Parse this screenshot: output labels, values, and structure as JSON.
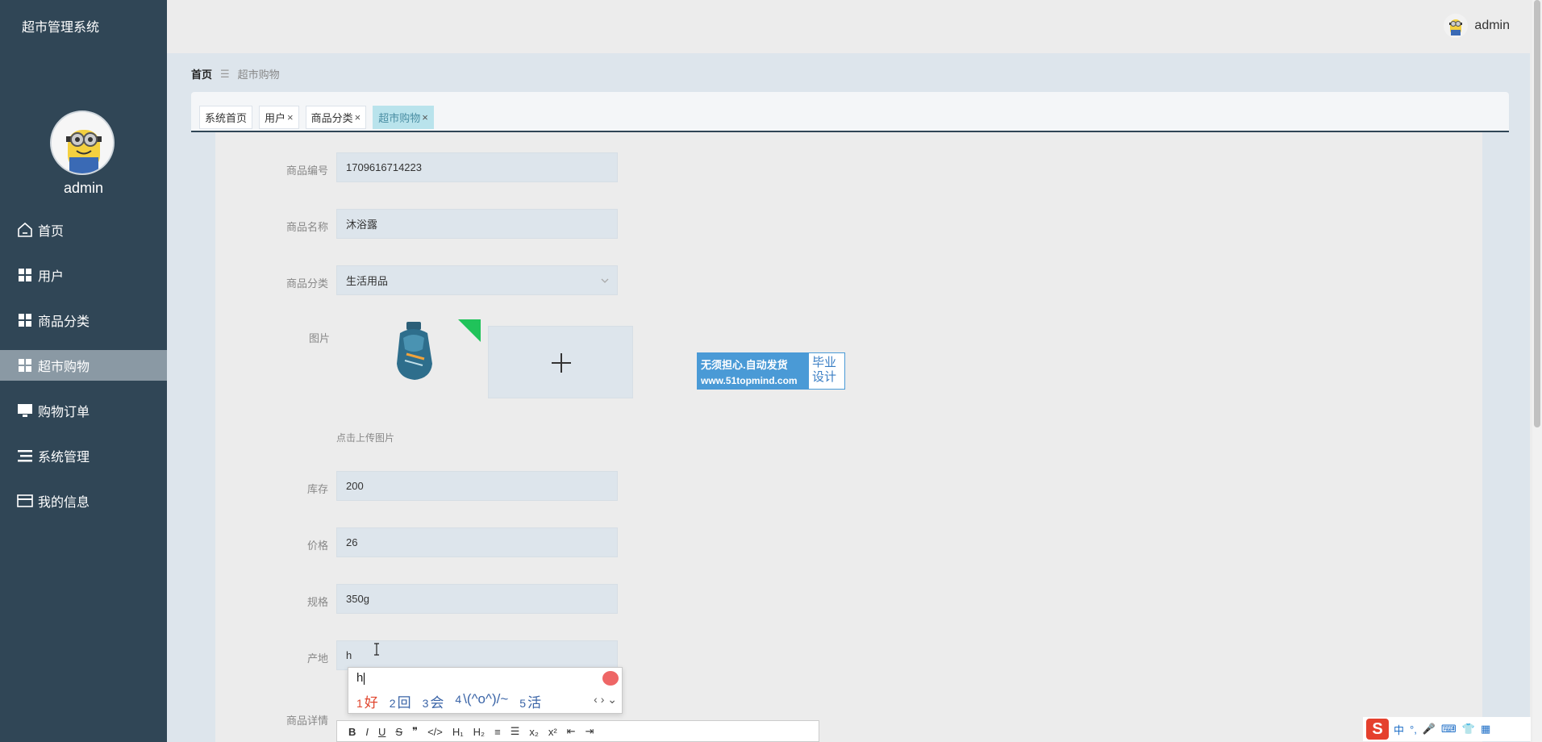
{
  "app": {
    "title": "超市管理系统"
  },
  "sidebar": {
    "username": "admin",
    "items": [
      {
        "label": "首页",
        "icon": "home-icon"
      },
      {
        "label": "用户",
        "icon": "grid-icon"
      },
      {
        "label": "商品分类",
        "icon": "grid-icon"
      },
      {
        "label": "超市购物",
        "icon": "grid-icon",
        "active": true
      },
      {
        "label": "购物订单",
        "icon": "monitor-icon"
      },
      {
        "label": "系统管理",
        "icon": "list-icon"
      },
      {
        "label": "我的信息",
        "icon": "card-icon"
      }
    ]
  },
  "header": {
    "username": "admin"
  },
  "breadcrumb": {
    "home": "首页",
    "current": "超市购物"
  },
  "tabs": [
    {
      "label": "系统首页",
      "closable": false
    },
    {
      "label": "用户",
      "closable": true
    },
    {
      "label": "商品分类",
      "closable": true
    },
    {
      "label": "超市购物",
      "closable": true,
      "active": true
    }
  ],
  "tab_close_glyph": "×",
  "form": {
    "code_label": "商品编号",
    "code_value": "1709616714223",
    "name_label": "商品名称",
    "name_value": "沐浴露",
    "category_label": "商品分类",
    "category_value": "生活用品",
    "image_label": "图片",
    "upload_hint": "点击上传图片",
    "stock_label": "库存",
    "stock_value": "200",
    "price_label": "价格",
    "price_value": "26",
    "spec_label": "规格",
    "spec_value": "350g",
    "origin_label": "产地",
    "origin_value": "h",
    "detail_label": "商品详情"
  },
  "promo": {
    "line1": "无须担心.自动发货",
    "line2": "www.51topmind.com",
    "right1": "毕业",
    "right2": "设计"
  },
  "editor_toolbar": [
    "B",
    "I",
    "U",
    "S",
    "❞",
    "</>",
    "H₁",
    "H₂",
    "≡",
    "☰",
    "x₂",
    "x²",
    "⇤",
    "⇥"
  ],
  "ime": {
    "input": "h",
    "candidates": [
      {
        "n": "1",
        "text": "好"
      },
      {
        "n": "2",
        "text": "回"
      },
      {
        "n": "3",
        "text": "会"
      },
      {
        "n": "4",
        "text": "\\(^o^)/~"
      },
      {
        "n": "5",
        "text": "活"
      }
    ],
    "nav": "‹ › ⌄"
  },
  "taskbar": {
    "logo": "S",
    "mode": "中",
    "punct": "°,"
  },
  "colors": {
    "sidebar": "#304656",
    "active_menu": "#8a99a4",
    "active_tab": "#b9e3ec",
    "field_bg": "#dde5ec",
    "corner_mark": "#20c35a",
    "promo_blue": "#4a9ad6"
  }
}
